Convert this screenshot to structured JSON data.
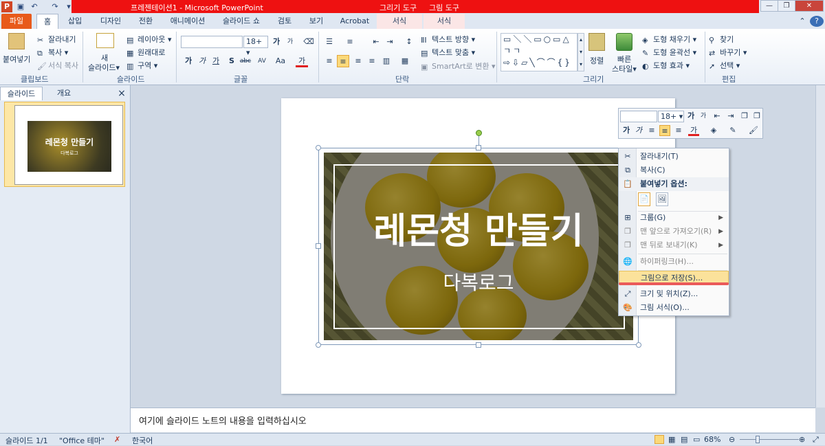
{
  "titlebar": {
    "title": "프레젠테이션1 - Microsoft PowerPoint",
    "context_tab_groups": [
      "그리기 도구",
      "그림 도구"
    ],
    "icons": [
      "powerpoint-logo-icon",
      "save-icon",
      "undo-icon",
      "redo-icon",
      "customize-qat-icon"
    ],
    "window_buttons": [
      "minimize",
      "restore",
      "close"
    ]
  },
  "tabs": [
    "파일",
    "홈",
    "삽입",
    "디자인",
    "전환",
    "애니메이션",
    "슬라이드 쇼",
    "검토",
    "보기",
    "Acrobat",
    "서식",
    "서식"
  ],
  "ribbon": {
    "clipboard": {
      "paste": "붙여넣기",
      "cut": "잘라내기",
      "copy": "복사",
      "format_painter": "서식 복사",
      "label": "클립보드"
    },
    "slides": {
      "new_slide_line1": "새",
      "new_slide_line2": "슬라이드",
      "layout": "레이아웃",
      "reset": "원래대로",
      "section": "구역",
      "label": "슬라이드"
    },
    "font": {
      "font_name": "",
      "font_size": "18+",
      "grow": "가",
      "shrink": "가",
      "bold": "가",
      "italic": "가",
      "underline": "가",
      "shadow": "S",
      "strike": "abc",
      "spacing": "AV",
      "case": "Aa",
      "color": "가",
      "label": "글꼴"
    },
    "paragraph": {
      "text_direction": "텍스트 방향",
      "align_text": "텍스트 맞춤",
      "smartart": "SmartArt로 변환",
      "label": "단락"
    },
    "drawing": {
      "arrange": "정렬",
      "quick_styles_line1": "빠른",
      "quick_styles_line2": "스타일",
      "fill": "도형 채우기",
      "outline": "도형 윤곽선",
      "effects": "도형 효과",
      "label": "그리기"
    },
    "editing": {
      "find": "찾기",
      "replace": "바꾸기",
      "select": "선택",
      "label": "편집"
    }
  },
  "panel": {
    "tabs": [
      "슬라이드",
      "개요"
    ],
    "close": "×",
    "slide_number": "1",
    "thumb_title": "레몬청 만들기",
    "thumb_subtitle": "다복로그"
  },
  "slide": {
    "title": "레몬청 만들기",
    "subtitle": "다복로그"
  },
  "mini_toolbar": {
    "font_name": "",
    "font_size": "18+",
    "grow": "가",
    "shrink": "가",
    "bold": "가",
    "italic": "가",
    "color": "가"
  },
  "context_menu": {
    "items": [
      {
        "label": "잘라내기(T)",
        "icon": "scissors-icon",
        "enabled": true
      },
      {
        "label": "복사(C)",
        "icon": "copy-icon",
        "enabled": true
      },
      {
        "label": "붙여넣기 옵션:",
        "icon": "paste-icon",
        "enabled": true
      },
      {
        "label": "그룹(G)",
        "icon": "group-icon",
        "enabled": true
      },
      {
        "label": "맨 앞으로 가져오기(R)",
        "icon": "bring-front-icon",
        "enabled": false
      },
      {
        "label": "맨 뒤로 보내기(K)",
        "icon": "send-back-icon",
        "enabled": false
      },
      {
        "label": "하이퍼링크(H)...",
        "icon": "hyperlink-icon",
        "enabled": false
      },
      {
        "label": "그림으로 저장(S)...",
        "icon": "",
        "enabled": true,
        "highlighted": true
      },
      {
        "label": "크기 및 위치(Z)...",
        "icon": "size-position-icon",
        "enabled": true
      },
      {
        "label": "그림 서식(O)...",
        "icon": "format-picture-icon",
        "enabled": true
      }
    ]
  },
  "notes": {
    "placeholder": "여기에 슬라이드 노트의 내용을 입력하십시오"
  },
  "status": {
    "slide": "슬라이드 1/1",
    "theme": "\"Office 테마\"",
    "language": "한국어",
    "zoom": "68%"
  },
  "colors": {
    "title_bar": "#ee1111",
    "file_tab": "#e85a1b",
    "highlight": "#fbe29b",
    "accent": "#1e395b"
  }
}
